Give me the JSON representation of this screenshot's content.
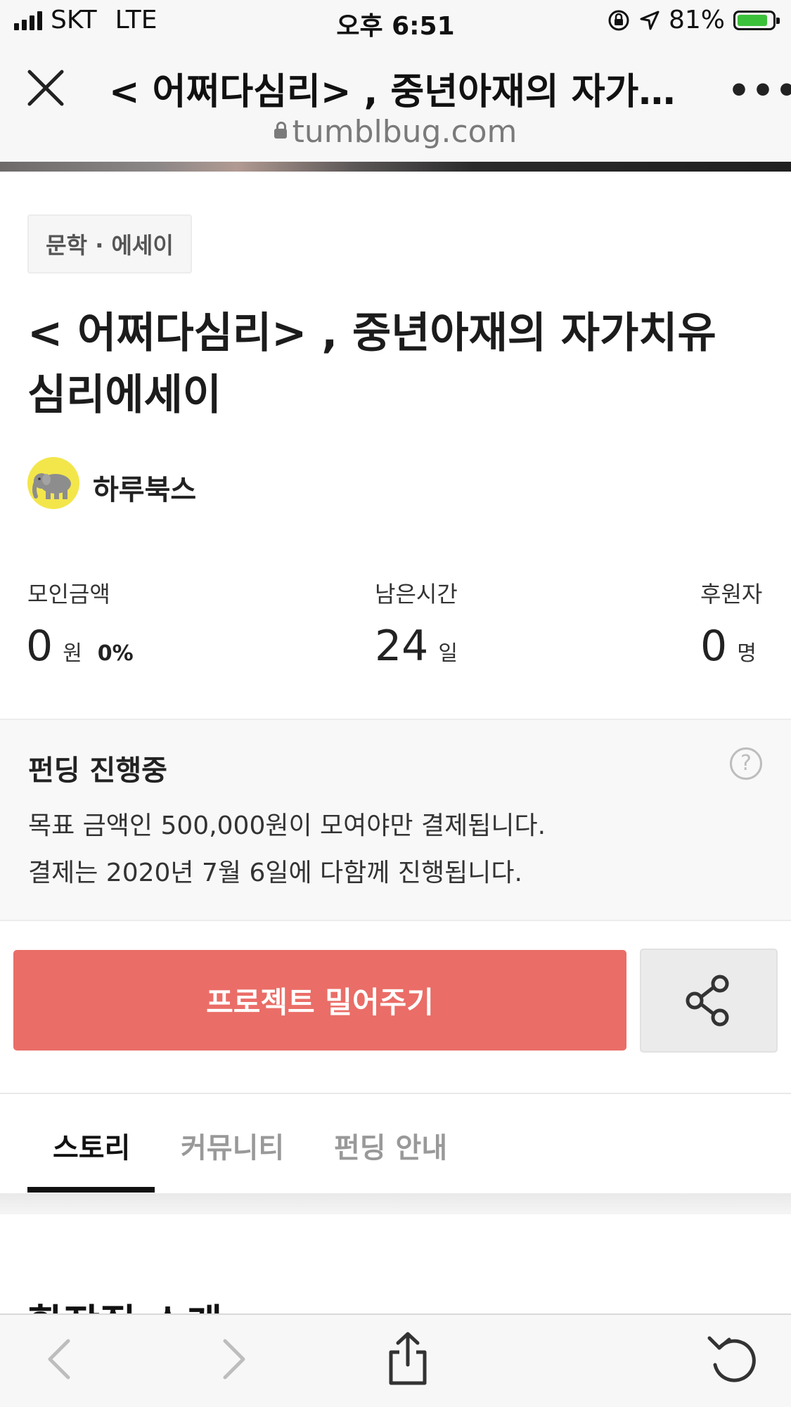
{
  "status_bar": {
    "carrier": "SKT",
    "network": "LTE",
    "time": "오후 6:51",
    "battery_pct": "81%"
  },
  "browser": {
    "tab_title": "< 어쩌다심리> , 중년아재의 자가…",
    "url": "tumblbug.com"
  },
  "project": {
    "category": "문학 · 에세이",
    "title_line1": "< 어쩌다심리> , 중년아재의 자가치유",
    "title_line2": "심리에세이",
    "creator": "하루북스"
  },
  "stats": {
    "raised_label": "모인금액",
    "raised_value": "0",
    "raised_unit": "원",
    "raised_percent": "0%",
    "remaining_label": "남은시간",
    "remaining_value": "24",
    "remaining_unit": "일",
    "backers_label": "후원자",
    "backers_value": "0",
    "backers_unit": "명"
  },
  "funding": {
    "status": "펀딩 진행중",
    "line1": "목표 금액인 500,000원이 모여야만 결제됩니다.",
    "line2": "결제는 2020년 7월 6일에 다함께 진행됩니다."
  },
  "actions": {
    "push_label": "프로젝트 밀어주기"
  },
  "tabs": [
    {
      "label": "스토리",
      "active": true
    },
    {
      "label": "커뮤니티",
      "active": false
    },
    {
      "label": "펀딩 안내",
      "active": false
    }
  ],
  "peek_heading": "환장질 스케",
  "colors": {
    "accent": "#ea6d67",
    "avatar_bg": "#f3e64b",
    "battery_fill": "#3cc13b"
  },
  "icons": [
    "close-icon",
    "more-icon",
    "lock-icon",
    "help-icon",
    "share-icon",
    "back-icon",
    "forward-icon",
    "share-sheet-icon",
    "reload-icon",
    "elephant-icon"
  ]
}
